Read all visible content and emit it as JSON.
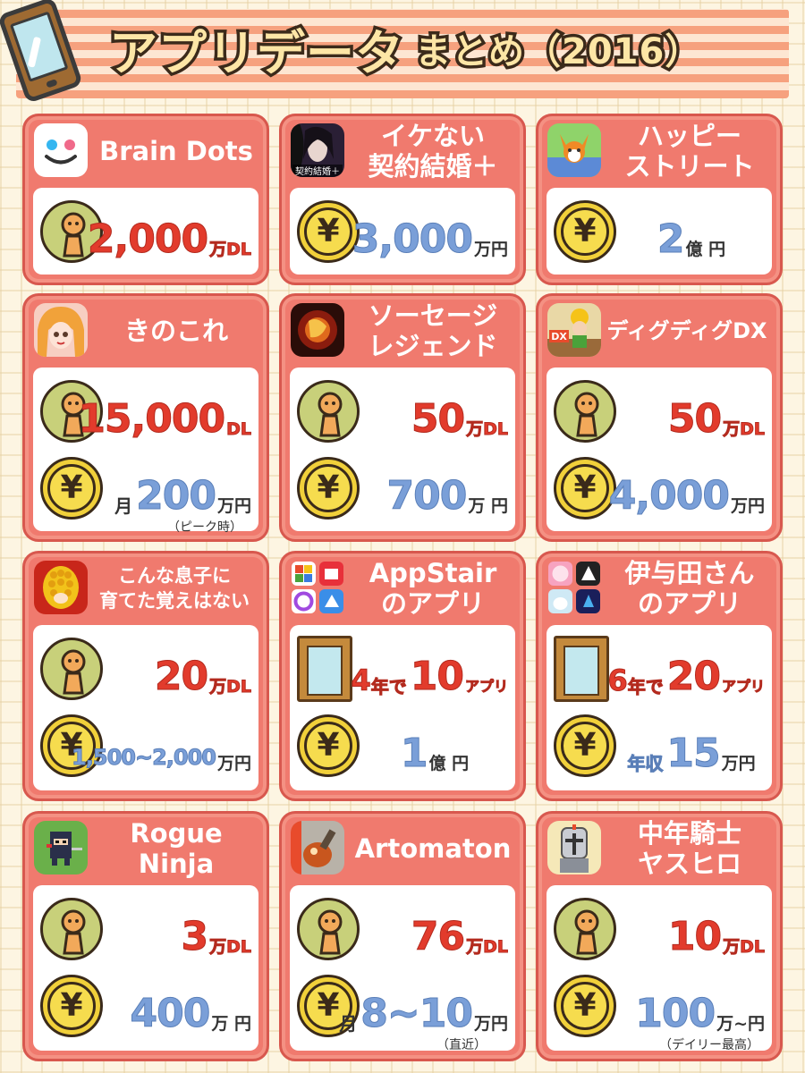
{
  "header": {
    "title": "アプリデータ",
    "title_suffix": "まとめ（2016）"
  },
  "colors": {
    "card": "#f07a6e",
    "dl_red": "#e23b2c",
    "money_blue": "#7a9fd8",
    "coin": "#f1d03a"
  },
  "cards": [
    {
      "name": "Brain Dots",
      "icon": "brain-dots-app-icon",
      "dl": {
        "pre": "",
        "value": "2,000",
        "unit": "万DL"
      }
    },
    {
      "name": "イケない\n契約結婚＋",
      "icon": "ikenai-keiyaku-app-icon",
      "icon_text": "契約結婚＋",
      "money": {
        "pre": "",
        "value": "3,000",
        "unit": "万円"
      }
    },
    {
      "name": "ハッピー\nストリート",
      "icon": "happy-street-app-icon",
      "money": {
        "pre": "",
        "value": "2",
        "unit": "億 円"
      }
    },
    {
      "name": "きのこれ",
      "icon": "kinokore-app-icon",
      "dl": {
        "pre": "",
        "value": "15,000",
        "unit": "DL"
      },
      "money": {
        "pre": "月",
        "value": "200",
        "unit": "万円",
        "note": "（ピーク時）"
      }
    },
    {
      "name": "ソーセージ\nレジェンド",
      "icon": "sausage-legend-app-icon",
      "dl": {
        "pre": "",
        "value": "50",
        "unit": "万DL"
      },
      "money": {
        "pre": "",
        "value": "700",
        "unit": "万 円"
      }
    },
    {
      "name": "ディグディグDX",
      "icon": "dig-dig-dx-app-icon",
      "icon_text": "DX",
      "dl": {
        "pre": "",
        "value": "50",
        "unit": "万DL"
      },
      "money": {
        "pre": "",
        "value": "4,000",
        "unit": "万円"
      }
    },
    {
      "name": "こんな息子に\n育てた覚えはない",
      "icon": "konna-musuko-app-icon",
      "dl": {
        "pre": "",
        "value": "20",
        "unit": "万DL"
      },
      "money": {
        "pre": "",
        "value": "1,500~2,000",
        "unit": "万円"
      }
    },
    {
      "name": "AppStair\nのアプリ",
      "icon": "appstair-apps-icon",
      "apps": {
        "pre": "4",
        "mid": "年で",
        "value": "10",
        "unit": "アプリ"
      },
      "money": {
        "pre": "",
        "value": "1",
        "unit": "億 円"
      }
    },
    {
      "name": "伊与田さん\nのアプリ",
      "icon": "iyoda-apps-icon",
      "apps": {
        "pre": "6",
        "mid": "年で",
        "value": "20",
        "unit": "アプリ"
      },
      "money": {
        "pre": "年収",
        "value": "15",
        "unit": "万円"
      }
    },
    {
      "name": "Rogue\nNinja",
      "icon": "rogue-ninja-app-icon",
      "dl": {
        "pre": "",
        "value": "3",
        "unit": "万DL"
      },
      "money": {
        "pre": "",
        "value": "400",
        "unit": "万 円"
      }
    },
    {
      "name": "Artomaton",
      "icon": "artomaton-app-icon",
      "dl": {
        "pre": "",
        "value": "76",
        "unit": "万DL"
      },
      "money": {
        "pre": "月",
        "value": "8~10",
        "unit": "万円",
        "note": "（直近）"
      }
    },
    {
      "name": "中年騎士\nヤスヒロ",
      "icon": "chunen-kishi-app-icon",
      "dl": {
        "pre": "",
        "value": "10",
        "unit": "万DL"
      },
      "money": {
        "pre": "",
        "value": "100",
        "unit": "万~円",
        "note": "（デイリー最高）"
      }
    }
  ]
}
